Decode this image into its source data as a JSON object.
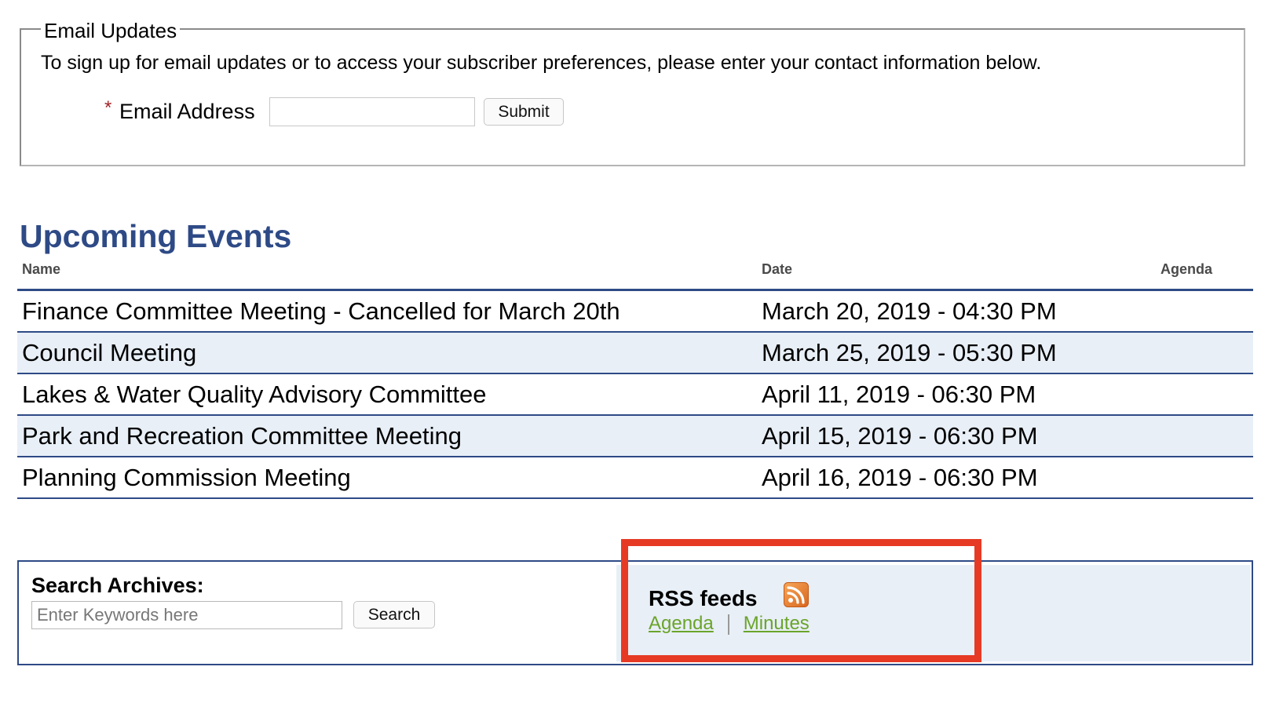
{
  "email_updates": {
    "legend": "Email Updates",
    "intro": "To sign up for email updates or to access your subscriber preferences, please enter your contact information below.",
    "required_marker": "*",
    "email_label": "Email Address",
    "email_value": "",
    "submit_label": "Submit"
  },
  "events": {
    "title": "Upcoming Events",
    "columns": {
      "name": "Name",
      "date": "Date",
      "agenda": "Agenda"
    },
    "rows": [
      {
        "name": "Finance Committee Meeting - Cancelled for March 20th",
        "date": "March 20, 2019 - 04:30 PM"
      },
      {
        "name": "Council Meeting",
        "date": "March 25, 2019 - 05:30 PM"
      },
      {
        "name": "Lakes & Water Quality Advisory Committee",
        "date": "April 11, 2019 - 06:30 PM"
      },
      {
        "name": "Park and Recreation Committee Meeting",
        "date": "April 15, 2019 - 06:30 PM"
      },
      {
        "name": "Planning Commission Meeting",
        "date": "April 16, 2019 - 06:30 PM"
      }
    ]
  },
  "archives": {
    "label": "Search Archives:",
    "placeholder": "Enter Keywords here",
    "search_label": "Search"
  },
  "rss": {
    "title": "RSS feeds",
    "icon": "rss-icon",
    "links": {
      "agenda": "Agenda",
      "minutes": "Minutes"
    }
  },
  "colors": {
    "heading_blue": "#2e4a86",
    "row_alt": "#e8eff7",
    "link_green": "#6ba42a",
    "highlight_red": "#e63a25",
    "rss_orange": "#f08a2c"
  }
}
